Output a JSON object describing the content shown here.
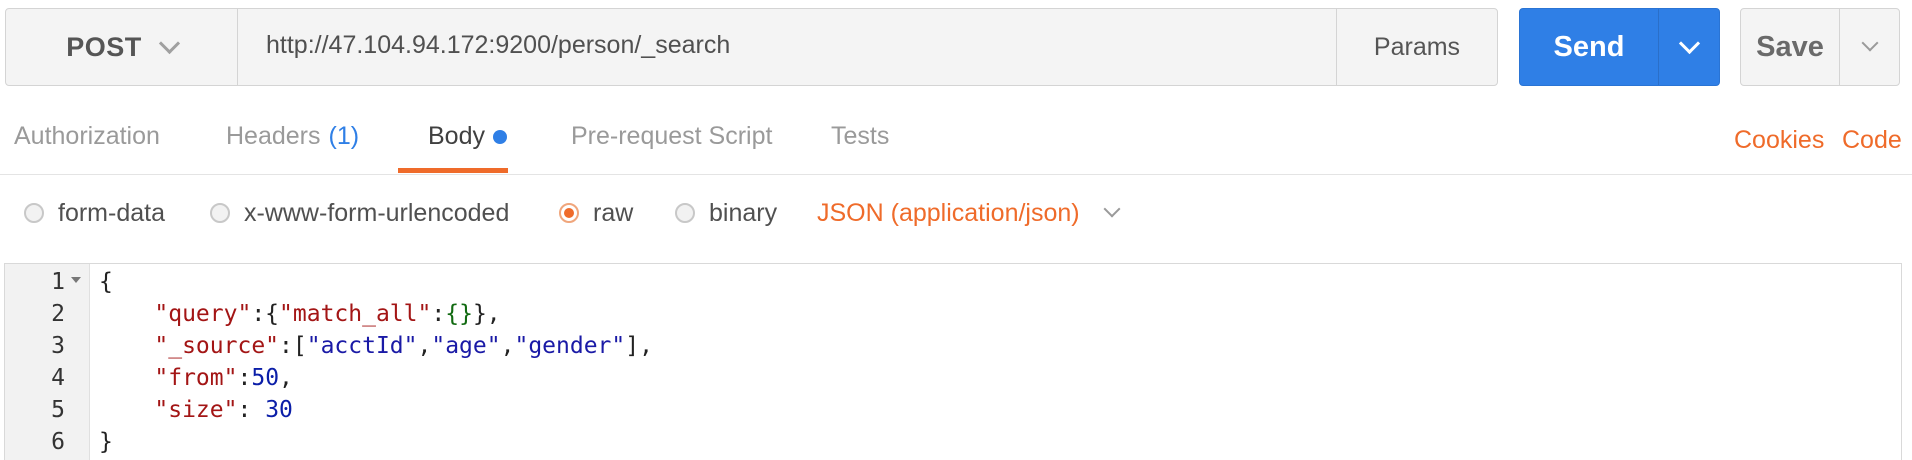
{
  "request": {
    "method": "POST",
    "url": "http://47.104.94.172:9200/person/_search",
    "params_label": "Params",
    "send_label": "Send",
    "save_label": "Save"
  },
  "tabs": [
    {
      "label": "Authorization"
    },
    {
      "label": "Headers",
      "count": "(1)"
    },
    {
      "label": "Body",
      "active": true
    },
    {
      "label": "Pre-request Script"
    },
    {
      "label": "Tests"
    }
  ],
  "links": {
    "cookies": "Cookies",
    "code": "Code"
  },
  "body_types": {
    "options": [
      "form-data",
      "x-www-form-urlencoded",
      "raw",
      "binary"
    ],
    "selected": "raw",
    "content_type": "JSON (application/json)"
  },
  "editor": {
    "line_numbers": [
      "1",
      "2",
      "3",
      "4",
      "5",
      "6"
    ],
    "lines": [
      "{",
      "    \"query\":{\"match_all\":{}},",
      "    \"_source\":[\"acctId\",\"age\",\"gender\"],",
      "    \"from\":50,",
      "    \"size\": 30",
      "}"
    ]
  },
  "colors": {
    "accent_orange": "#ef6b2a",
    "send_blue": "#2f7fe6"
  }
}
